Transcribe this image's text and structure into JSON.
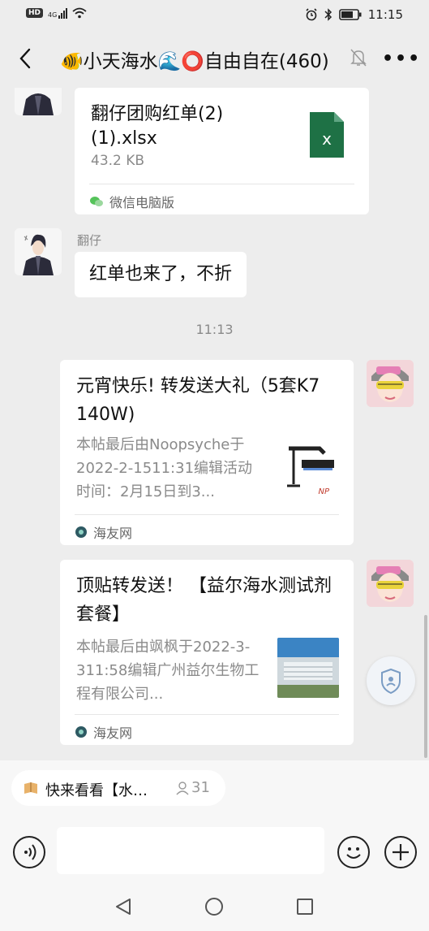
{
  "status_bar": {
    "time": "11:15",
    "network": "4G"
  },
  "header": {
    "title": "🐠小天海水🌊⭕自由自在(460)"
  },
  "messages": [
    {
      "type": "file",
      "name": "翻仔团购红单(2)(1).xlsx",
      "size": "43.2 KB",
      "source": "微信电脑版"
    },
    {
      "type": "text",
      "sender": "翻仔",
      "text": "红单也来了，不折"
    },
    {
      "type": "time",
      "text": "11:13"
    },
    {
      "type": "link",
      "title": "元宵快乐! 转发送大礼（5套K7  140W)",
      "desc": "本帖最后由Noopsyche于2022-2-1511:31编辑活动时间：2月15日到3...",
      "source": "海友网"
    },
    {
      "type": "link",
      "title": "顶贴转发送！ 【益尔海水测试剂套餐】",
      "desc": "本帖最后由飒枫于2022-3-311:58编辑广州益尔生物工程有限公司...",
      "source": "海友网"
    }
  ],
  "pinned": {
    "text": "快来看看【水…",
    "count": "31"
  },
  "colors": {
    "bg": "#ededed",
    "bubble": "#ffffff",
    "excel_green": "#1e7145",
    "muted": "#8a8a8a"
  }
}
